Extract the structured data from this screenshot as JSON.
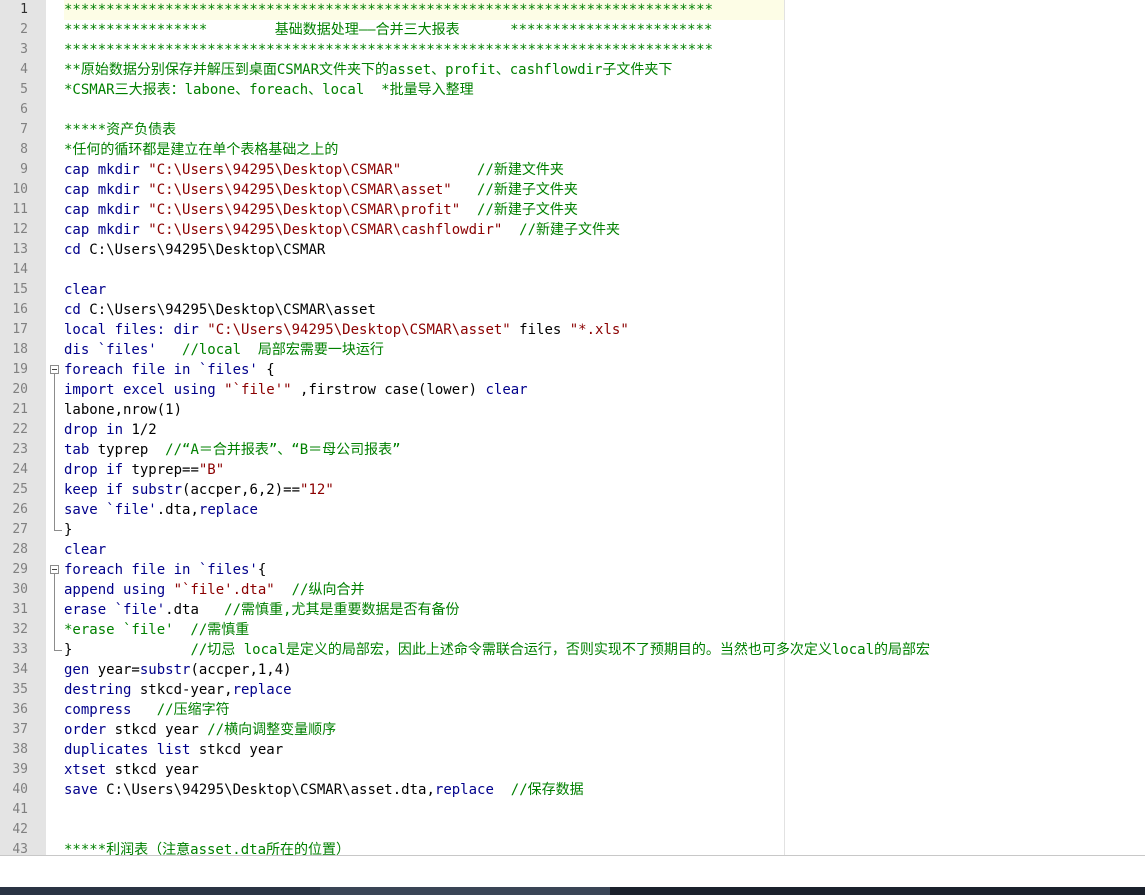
{
  "lines": [
    {
      "n": "1",
      "segs": [
        {
          "t": "*****************************************************************************",
          "c": "g"
        }
      ]
    },
    {
      "n": "2",
      "segs": [
        {
          "t": "*****************        基础数据处理——合并三大报表      ************************",
          "c": "g"
        }
      ]
    },
    {
      "n": "3",
      "segs": [
        {
          "t": "*****************************************************************************",
          "c": "g"
        }
      ]
    },
    {
      "n": "4",
      "segs": [
        {
          "t": "**原始数据分别保存并解压到桌面CSMAR文件夹下的asset、profit、cashflowdir子文件夹下",
          "c": "g"
        }
      ]
    },
    {
      "n": "5",
      "segs": [
        {
          "t": "*CSMAR三大报表：labone、foreach、local  *批量导入整理",
          "c": "g"
        }
      ]
    },
    {
      "n": "6",
      "segs": []
    },
    {
      "n": "7",
      "segs": [
        {
          "t": "*****资产负债表",
          "c": "g"
        }
      ]
    },
    {
      "n": "8",
      "segs": [
        {
          "t": "*任何的循环都是建立在单个表格基础之上的",
          "c": "g"
        }
      ]
    },
    {
      "n": "9",
      "segs": [
        {
          "t": "cap mkdir ",
          "c": "b"
        },
        {
          "t": "\"C:\\Users\\94295\\Desktop\\CSMAR\"",
          "c": "s"
        },
        {
          "t": "         //新建文件夹",
          "c": "g"
        }
      ]
    },
    {
      "n": "10",
      "segs": [
        {
          "t": "cap mkdir ",
          "c": "b"
        },
        {
          "t": "\"C:\\Users\\94295\\Desktop\\CSMAR\\asset\"",
          "c": "s"
        },
        {
          "t": "   //新建子文件夹",
          "c": "g"
        }
      ]
    },
    {
      "n": "11",
      "segs": [
        {
          "t": "cap mkdir ",
          "c": "b"
        },
        {
          "t": "\"C:\\Users\\94295\\Desktop\\CSMAR\\profit\"",
          "c": "s"
        },
        {
          "t": "  //新建子文件夹",
          "c": "g"
        }
      ]
    },
    {
      "n": "12",
      "segs": [
        {
          "t": "cap mkdir ",
          "c": "b"
        },
        {
          "t": "\"C:\\Users\\94295\\Desktop\\CSMAR\\cashflowdir\"",
          "c": "s"
        },
        {
          "t": "  //新建子文件夹",
          "c": "g"
        }
      ]
    },
    {
      "n": "13",
      "segs": [
        {
          "t": "cd ",
          "c": "b"
        },
        {
          "t": "C:\\Users\\94295\\Desktop\\CSMAR",
          "c": "k"
        }
      ]
    },
    {
      "n": "14",
      "segs": []
    },
    {
      "n": "15",
      "segs": [
        {
          "t": "clear",
          "c": "b"
        }
      ]
    },
    {
      "n": "16",
      "segs": [
        {
          "t": "cd ",
          "c": "b"
        },
        {
          "t": "C:\\Users\\94295\\Desktop\\CSMAR\\asset",
          "c": "k"
        }
      ]
    },
    {
      "n": "17",
      "segs": [
        {
          "t": "local files: dir ",
          "c": "b"
        },
        {
          "t": "\"C:\\Users\\94295\\Desktop\\CSMAR\\asset\"",
          "c": "s"
        },
        {
          "t": " files ",
          "c": "k"
        },
        {
          "t": "\"*.xls\"",
          "c": "s"
        }
      ]
    },
    {
      "n": "18",
      "segs": [
        {
          "t": "dis ",
          "c": "b"
        },
        {
          "t": "`files'",
          "c": "b"
        },
        {
          "t": "   //local  局部宏需要一块运行",
          "c": "g"
        }
      ]
    },
    {
      "n": "19",
      "segs": [
        {
          "t": "foreach file in ",
          "c": "b"
        },
        {
          "t": "`files'",
          "c": "b"
        },
        {
          "t": " {",
          "c": "k"
        }
      ]
    },
    {
      "n": "20",
      "segs": [
        {
          "t": "import excel using ",
          "c": "b"
        },
        {
          "t": "\"`file'\"",
          "c": "s"
        },
        {
          "t": " ,firstrow case(lower) ",
          "c": "k"
        },
        {
          "t": "clear",
          "c": "b"
        }
      ]
    },
    {
      "n": "21",
      "segs": [
        {
          "t": "labone,nrow(1)",
          "c": "k"
        }
      ]
    },
    {
      "n": "22",
      "segs": [
        {
          "t": "drop in ",
          "c": "b"
        },
        {
          "t": "1/2",
          "c": "k"
        }
      ]
    },
    {
      "n": "23",
      "segs": [
        {
          "t": "tab ",
          "c": "b"
        },
        {
          "t": "typrep  ",
          "c": "k"
        },
        {
          "t": "//“A＝合并报表”、“B＝母公司报表”",
          "c": "g"
        }
      ]
    },
    {
      "n": "24",
      "segs": [
        {
          "t": "drop if ",
          "c": "b"
        },
        {
          "t": "typrep==",
          "c": "k"
        },
        {
          "t": "\"B\"",
          "c": "s"
        }
      ]
    },
    {
      "n": "25",
      "segs": [
        {
          "t": "keep if substr",
          "c": "b"
        },
        {
          "t": "(accper,6,2)==",
          "c": "k"
        },
        {
          "t": "\"12\"",
          "c": "s"
        }
      ]
    },
    {
      "n": "26",
      "segs": [
        {
          "t": "save ",
          "c": "b"
        },
        {
          "t": "`file'",
          "c": "b"
        },
        {
          "t": ".dta,",
          "c": "k"
        },
        {
          "t": "replace",
          "c": "b"
        }
      ]
    },
    {
      "n": "27",
      "segs": [
        {
          "t": "}",
          "c": "k"
        }
      ]
    },
    {
      "n": "28",
      "segs": [
        {
          "t": "clear",
          "c": "b"
        }
      ]
    },
    {
      "n": "29",
      "segs": [
        {
          "t": "foreach file in ",
          "c": "b"
        },
        {
          "t": "`files'",
          "c": "b"
        },
        {
          "t": "{",
          "c": "k"
        }
      ]
    },
    {
      "n": "30",
      "segs": [
        {
          "t": "append using ",
          "c": "b"
        },
        {
          "t": "\"`file'.dta\"",
          "c": "s"
        },
        {
          "t": "  //纵向合并",
          "c": "g"
        }
      ]
    },
    {
      "n": "31",
      "segs": [
        {
          "t": "erase ",
          "c": "b"
        },
        {
          "t": "`file'",
          "c": "b"
        },
        {
          "t": ".dta   ",
          "c": "k"
        },
        {
          "t": "//需慎重,尤其是重要数据是否有备份",
          "c": "g"
        }
      ]
    },
    {
      "n": "32",
      "segs": [
        {
          "t": "*erase `file'  //需慎重",
          "c": "g"
        }
      ]
    },
    {
      "n": "33",
      "segs": [
        {
          "t": "}",
          "c": "k"
        },
        {
          "t": "              //切忌 local是定义的局部宏，因此上述命令需联合运行，否则实现不了预期目的。当然也可多次定义local的局部宏",
          "c": "g"
        }
      ]
    },
    {
      "n": "34",
      "segs": [
        {
          "t": "gen ",
          "c": "b"
        },
        {
          "t": "year=",
          "c": "k"
        },
        {
          "t": "substr",
          "c": "b"
        },
        {
          "t": "(accper,1,4)",
          "c": "k"
        }
      ]
    },
    {
      "n": "35",
      "segs": [
        {
          "t": "destring ",
          "c": "b"
        },
        {
          "t": "stkcd-year,",
          "c": "k"
        },
        {
          "t": "replace",
          "c": "b"
        }
      ]
    },
    {
      "n": "36",
      "segs": [
        {
          "t": "compress",
          "c": "b"
        },
        {
          "t": "   //压缩字符",
          "c": "g"
        }
      ]
    },
    {
      "n": "37",
      "segs": [
        {
          "t": "order ",
          "c": "b"
        },
        {
          "t": "stkcd year ",
          "c": "k"
        },
        {
          "t": "//横向调整变量顺序",
          "c": "g"
        }
      ]
    },
    {
      "n": "38",
      "segs": [
        {
          "t": "duplicates list ",
          "c": "b"
        },
        {
          "t": "stkcd year",
          "c": "k"
        }
      ]
    },
    {
      "n": "39",
      "segs": [
        {
          "t": "xtset ",
          "c": "b"
        },
        {
          "t": "stkcd year",
          "c": "k"
        }
      ]
    },
    {
      "n": "40",
      "segs": [
        {
          "t": "save ",
          "c": "b"
        },
        {
          "t": "C:\\Users\\94295\\Desktop\\CSMAR\\asset.dta,",
          "c": "k"
        },
        {
          "t": "replace",
          "c": "b"
        },
        {
          "t": "  //保存数据",
          "c": "g"
        }
      ]
    },
    {
      "n": "41",
      "segs": []
    },
    {
      "n": "42",
      "segs": []
    },
    {
      "n": "43",
      "segs": [
        {
          "t": "*****利润表（注意asset.dta所在的位置）",
          "c": "g"
        }
      ]
    }
  ],
  "current_line": "1",
  "colors": {
    "comment": "#008000",
    "keyword": "#00008b",
    "string": "#8b0000",
    "gutter": "#e4e4e4",
    "current_line": "#fdfde6"
  }
}
